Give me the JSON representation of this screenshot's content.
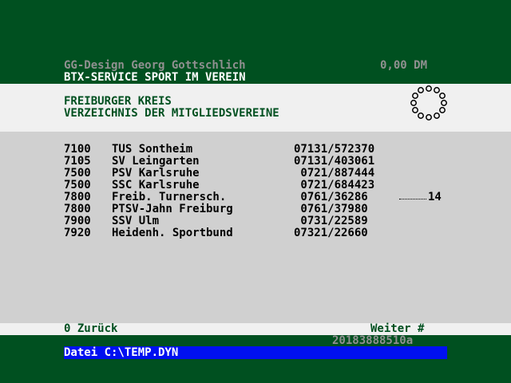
{
  "header": {
    "provider": "GG-Design Georg Gottschlich",
    "price": "0,00 DM",
    "service": "BTX-SERVICE SPORT IM VEREIN"
  },
  "title": {
    "line1": "FREIBURGER KREIS",
    "line2": "VERZEICHNIS DER MITGLIEDSVEREINE"
  },
  "clubs": [
    {
      "plz": "7100",
      "name": "TUS Sontheim",
      "phone": "07131/572370"
    },
    {
      "plz": "7105",
      "name": "SV Leingarten",
      "phone": "07131/403061"
    },
    {
      "plz": "7500",
      "name": "PSV Karlsruhe",
      "phone": " 0721/887444"
    },
    {
      "plz": "7500",
      "name": "SSC Karlsruhe",
      "phone": " 0721/684423"
    },
    {
      "plz": "7800",
      "name": "Freib. Turnersch.",
      "phone": " 0761/36286",
      "extra": "14"
    },
    {
      "plz": "7800",
      "name": "PTSV-Jahn Freiburg",
      "phone": " 0761/37980"
    },
    {
      "plz": "7900",
      "name": "SSV Ulm",
      "phone": " 0731/22589"
    },
    {
      "plz": "7920",
      "name": "Heidenh. Sportbund",
      "phone": "07321/22660"
    }
  ],
  "nav": {
    "back": "0 Zurück",
    "next": "Weiter #"
  },
  "page_id": "20183888510a",
  "file": "Datei C:\\TEMP.DYN",
  "colors": {
    "background": "#005020",
    "panel_light": "#f0f0f0",
    "panel_grey": "#d0d0d0",
    "file_bar": "#0010f0"
  }
}
